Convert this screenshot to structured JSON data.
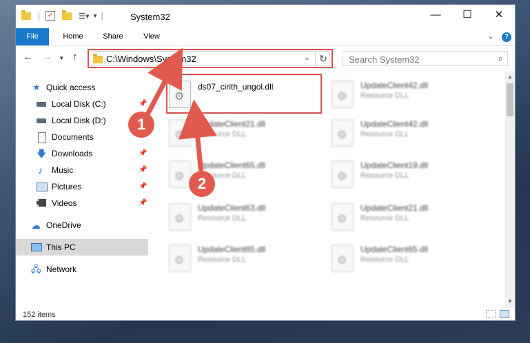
{
  "window": {
    "title": "System32",
    "controls": {
      "minimize": "—",
      "maximize": "☐",
      "close": "✕"
    }
  },
  "ribbon": {
    "tabs": [
      "File",
      "Home",
      "Share",
      "View"
    ],
    "help": "?"
  },
  "address": {
    "path": "C:\\Windows\\System32",
    "search_placeholder": "Search System32"
  },
  "nav_pane": {
    "quick_access": "Quick access",
    "items": [
      {
        "label": "Local Disk (C:)",
        "icon": "drive-icon",
        "pinned": true
      },
      {
        "label": "Local Disk (D:)",
        "icon": "drive-icon",
        "pinned": false
      },
      {
        "label": "Documents",
        "icon": "documents-icon",
        "pinned": false
      },
      {
        "label": "Downloads",
        "icon": "downloads-icon",
        "pinned": true
      },
      {
        "label": "Music",
        "icon": "music-icon",
        "pinned": true
      },
      {
        "label": "Pictures",
        "icon": "pictures-icon",
        "pinned": true
      },
      {
        "label": "Videos",
        "icon": "videos-icon",
        "pinned": true
      }
    ],
    "onedrive": "OneDrive",
    "this_pc": "This PC",
    "network": "Network"
  },
  "files": {
    "target": {
      "name": "ds07_cirith_ungol.dll",
      "type": ""
    },
    "left": [
      {
        "name": "UpdateClient21.dll",
        "type": "Resource DLL"
      },
      {
        "name": "UpdateClient65.dll",
        "type": "Resource DLL"
      },
      {
        "name": "UpdateClient63.dll",
        "type": "Resource DLL"
      },
      {
        "name": "UpdateClient65.dll",
        "type": "Resource DLL"
      }
    ],
    "right": [
      {
        "name": "UpdateClient42.dll",
        "type": "Resource DLL"
      },
      {
        "name": "UpdateClient42.dll",
        "type": "Resource DLL"
      },
      {
        "name": "UpdateClient19.dll",
        "type": "Resource DLL"
      },
      {
        "name": "UpdateClient21.dll",
        "type": "Resource DLL"
      },
      {
        "name": "UpdateClient65.dll",
        "type": "Resource DLL"
      }
    ]
  },
  "status": {
    "item_count": "152 items"
  },
  "annotations": {
    "step1": "1",
    "step2": "2",
    "color": "#e05a4f"
  }
}
